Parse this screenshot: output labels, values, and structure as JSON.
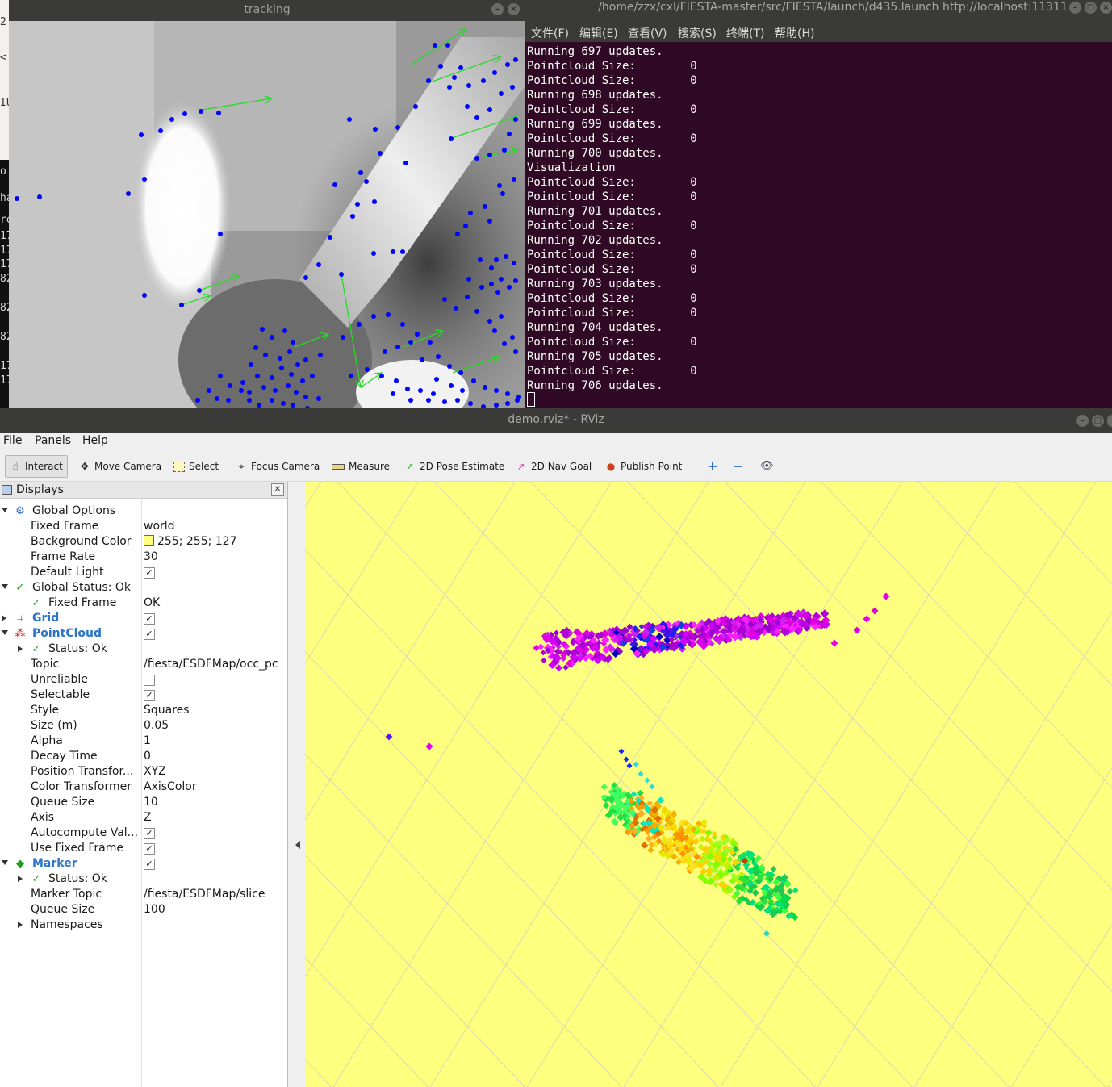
{
  "edge_fragment": {
    "lines": [
      "2",
      "<",
      "IU",
      "o",
      "ha",
      "ro",
      "17",
      "17",
      "17",
      "82",
      "82",
      "82",
      "17",
      "17"
    ]
  },
  "tracking": {
    "title": "tracking",
    "buttons": [
      "–",
      "×"
    ]
  },
  "terminal": {
    "title": "/home/zzx/cxl/FIESTA-master/src/FIESTA/launch/d435.launch http://localhost:11311",
    "menu": [
      "文件(F)",
      "编辑(E)",
      "查看(V)",
      "搜索(S)",
      "终端(T)",
      "帮助(H)"
    ],
    "lines": [
      "Running 697 updates.",
      "Pointcloud Size:        0",
      "Pointcloud Size:        0",
      "Running 698 updates.",
      "Pointcloud Size:        0",
      "Running 699 updates.",
      "Pointcloud Size:        0",
      "Running 700 updates.",
      "Visualization",
      "Pointcloud Size:        0",
      "Pointcloud Size:        0",
      "Running 701 updates.",
      "Pointcloud Size:        0",
      "Running 702 updates.",
      "Pointcloud Size:        0",
      "Pointcloud Size:        0",
      "Running 703 updates.",
      "Pointcloud Size:        0",
      "Pointcloud Size:        0",
      "Running 704 updates.",
      "Pointcloud Size:        0",
      "Running 705 updates.",
      "Pointcloud Size:        0",
      "Running 706 updates."
    ]
  },
  "rviz": {
    "title": "demo.rviz* - RViz",
    "menu": {
      "file": "File",
      "panels": "Panels",
      "help": "Help"
    },
    "toolbar": {
      "interact": "Interact",
      "move_camera": "Move Camera",
      "select": "Select",
      "focus_camera": "Focus Camera",
      "measure": "Measure",
      "pose_estimate": "2D Pose Estimate",
      "nav_goal": "2D Nav Goal",
      "publish_point": "Publish Point"
    },
    "displays": {
      "title": "Displays",
      "rows": [
        {
          "label": "Global Options",
          "value": ""
        },
        {
          "label": "Fixed Frame",
          "value": "world"
        },
        {
          "label": "Background Color",
          "value": "255; 255; 127"
        },
        {
          "label": "Frame Rate",
          "value": "30"
        },
        {
          "label": "Default Light",
          "value": ""
        },
        {
          "label": "Global Status: Ok",
          "value": ""
        },
        {
          "label": "Fixed Frame",
          "value": "OK"
        },
        {
          "label": "Grid",
          "value": ""
        },
        {
          "label": "PointCloud",
          "value": ""
        },
        {
          "label": "Status: Ok",
          "value": ""
        },
        {
          "label": "Topic",
          "value": "/fiesta/ESDFMap/occ_pc"
        },
        {
          "label": "Unreliable",
          "value": ""
        },
        {
          "label": "Selectable",
          "value": ""
        },
        {
          "label": "Style",
          "value": "Squares"
        },
        {
          "label": "Size (m)",
          "value": "0.05"
        },
        {
          "label": "Alpha",
          "value": "1"
        },
        {
          "label": "Decay Time",
          "value": "0"
        },
        {
          "label": "Position Transfor...",
          "value": "XYZ"
        },
        {
          "label": "Color Transformer",
          "value": "AxisColor"
        },
        {
          "label": "Queue Size",
          "value": "10"
        },
        {
          "label": "Axis",
          "value": "Z"
        },
        {
          "label": "Autocompute Val...",
          "value": ""
        },
        {
          "label": "Use Fixed Frame",
          "value": ""
        },
        {
          "label": "Marker",
          "value": ""
        },
        {
          "label": "Status: Ok",
          "value": ""
        },
        {
          "label": "Marker Topic",
          "value": "/fiesta/ESDFMap/slice"
        },
        {
          "label": "Queue Size",
          "value": "100"
        },
        {
          "label": "Namespaces",
          "value": ""
        }
      ],
      "checkboxes": {
        "default_light": true,
        "grid": true,
        "pointcloud": true,
        "unreliable": false,
        "selectable": true,
        "autocompute": true,
        "use_fixed_frame": true,
        "marker": true
      }
    },
    "colors": {
      "background": "#ffff7f",
      "terminal_bg": "#300a24",
      "feature_point": "#0000ff",
      "flow_arrow": "#22dd22",
      "accent_blue": "#2a74c9"
    }
  }
}
